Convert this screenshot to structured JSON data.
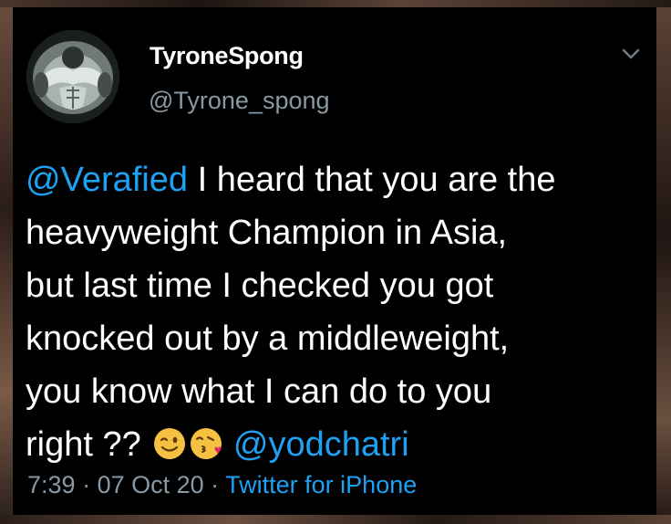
{
  "tweet": {
    "author_name": "TyroneSpong",
    "author_handle": "@Tyrone_spong",
    "mention_1": "@Verafied",
    "line1_rest": " I heard that you are the",
    "line2": "heavyweight Champion in Asia,",
    "line3": "but last time I checked you got",
    "line4": "knocked out by a middleweight,",
    "line5": "you know what I can do to you",
    "line6_text": "right ?? ",
    "mention_2": "@yodchatri",
    "time": "7:39",
    "separator": " · ",
    "date": "07 Oct 20",
    "source": "Twitter for iPhone"
  },
  "icons": {
    "chevron": "chevron-down-icon",
    "emoji_1": "winking-face-emoji",
    "emoji_2": "face-blowing-kiss-emoji"
  },
  "colors": {
    "background": "#000000",
    "text": "#ffffff",
    "secondary": "#8899a6",
    "link": "#1da1f2",
    "emoji_yellow": "#f6c042"
  }
}
